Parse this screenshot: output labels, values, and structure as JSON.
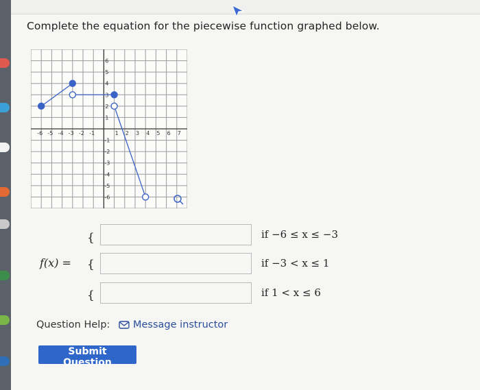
{
  "question": {
    "prompt": "Complete the equation for the piecewise function graphed below."
  },
  "graph": {
    "x_ticks": [
      "-6",
      "-5",
      "-4",
      "-3",
      "-2",
      "-1",
      "1",
      "2",
      "3",
      "4",
      "5",
      "6",
      "7"
    ],
    "y_ticks_pos": [
      "6",
      "5",
      "4",
      "3",
      "2",
      "1"
    ],
    "y_ticks_neg": [
      "-1",
      "-2",
      "-3",
      "-4",
      "-5",
      "-6"
    ],
    "curve_color": "#3a63c7",
    "segments": [
      {
        "from": [
          -6,
          2
        ],
        "to": [
          -3,
          4
        ],
        "from_closed": true,
        "to_closed": true
      },
      {
        "from": [
          -3,
          3
        ],
        "to": [
          1,
          3
        ],
        "from_closed": false,
        "to_closed": true
      },
      {
        "from": [
          1,
          2
        ],
        "to": [
          4,
          -6
        ],
        "from_closed": false,
        "to_closed": false
      }
    ],
    "magnify_icon": "magnifier-icon"
  },
  "equation": {
    "lhs": "f(x) =",
    "pieces": [
      {
        "brace": "{",
        "condition": "if −6 ≤ x ≤ −3",
        "value": ""
      },
      {
        "brace": "{",
        "condition": "if −3 < x ≤ 1",
        "value": ""
      },
      {
        "brace": "{",
        "condition": "if 1 < x ≤ 6",
        "value": ""
      }
    ]
  },
  "help": {
    "label": "Question Help:",
    "link_text": "Message instructor",
    "link_icon": "envelope-icon"
  },
  "submit": {
    "label": "Submit Question"
  }
}
